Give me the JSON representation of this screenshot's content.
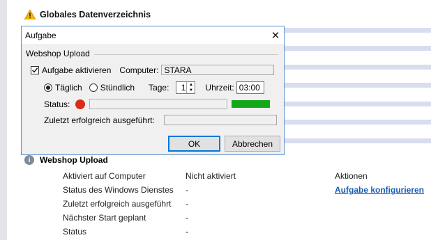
{
  "section": {
    "title": "Globales Datenverzeichnis",
    "icon": "warning-icon"
  },
  "dialog": {
    "title": "Aufgabe",
    "close_glyph": "✕",
    "group_label": "Webshop Upload",
    "enable_label": "Aufgabe aktivieren",
    "enable_checked": true,
    "computer_label": "Computer:",
    "computer_value": "STARA",
    "daily_label": "Täglich",
    "hourly_label": "Stündlich",
    "schedule_selected": "Täglich",
    "days_label": "Tage:",
    "days_value": "1",
    "time_label": "Uhrzeit:",
    "time_value": "03:00",
    "status_label": "Status:",
    "status_color": "#d82c1c",
    "progress_color": "#12a818",
    "last_success_label": "Zuletzt erfolgreich ausgeführt:",
    "last_success_value": "",
    "ok_label": "OK",
    "cancel_label": "Abbrechen"
  },
  "info": {
    "title": "Webshop Upload",
    "icon": "info-icon",
    "rows": [
      {
        "label": "Aktiviert auf Computer",
        "value": "Nicht aktiviert",
        "extra": "Aktionen"
      },
      {
        "label": "Status des Windows Dienstes",
        "value": "-",
        "extra": "Aufgabe konfigurieren"
      },
      {
        "label": "Zuletzt erfolgreich ausgeführt",
        "value": "-",
        "extra": ""
      },
      {
        "label": "Nächster Start geplant",
        "value": "-",
        "extra": ""
      },
      {
        "label": "Status",
        "value": "-",
        "extra": ""
      }
    ]
  }
}
